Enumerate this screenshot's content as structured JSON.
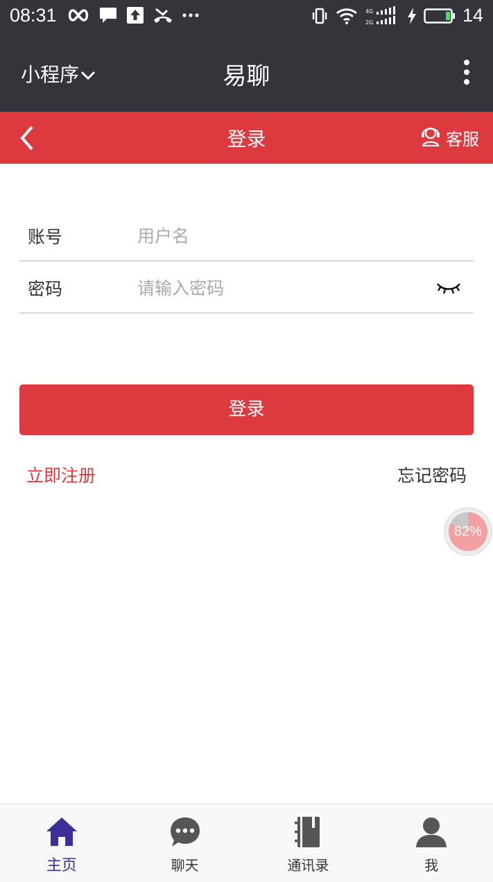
{
  "status_bar": {
    "time": "08:31",
    "battery_level": "14"
  },
  "mini_program": {
    "menu_label": "小程序",
    "app_title": "易聊"
  },
  "nav": {
    "title": "登录",
    "service_label": "客服"
  },
  "form": {
    "account_label": "账号",
    "account_placeholder": "用户名",
    "account_value": "",
    "password_label": "密码",
    "password_placeholder": "请输入密码",
    "password_value": ""
  },
  "actions": {
    "login_label": "登录",
    "register_label": "立即注册",
    "forgot_label": "忘记密码"
  },
  "floating_badge": {
    "text": "82%",
    "value": 82
  },
  "tabs": [
    {
      "label": "主页",
      "icon": "home-icon",
      "active": true
    },
    {
      "label": "聊天",
      "icon": "chat-icon",
      "active": false
    },
    {
      "label": "通讯录",
      "icon": "contacts-book-icon",
      "active": false
    },
    {
      "label": "我",
      "icon": "user-icon",
      "active": false
    }
  ],
  "colors": {
    "header_bg": "#34353b",
    "brand_red": "#dc3a3f",
    "active_tab": "#3d2f9a",
    "inactive_tab_icon": "#555555"
  }
}
